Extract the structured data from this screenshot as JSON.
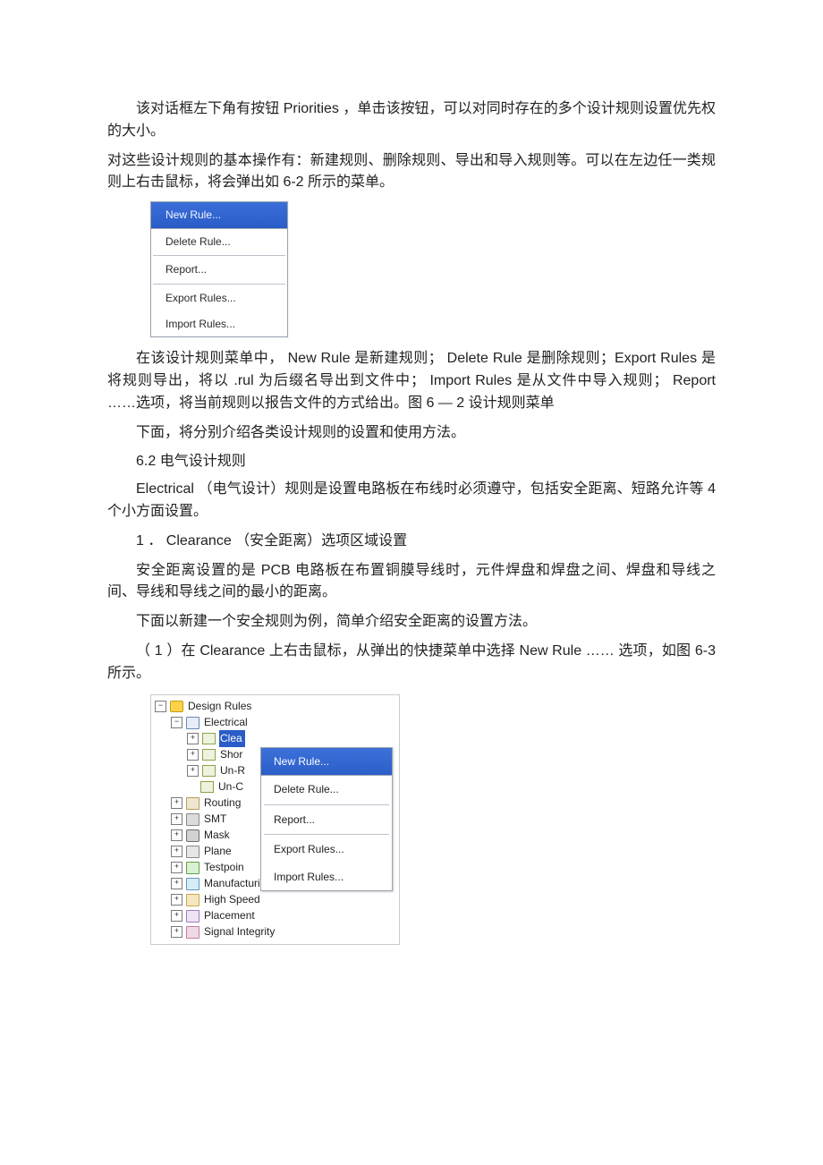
{
  "paragraphs": {
    "p1": "该对话框左下角有按钮 Priorities ，单击该按钮，可以对同时存在的多个设计规则设置优先权的大小。",
    "p2": "对这些设计规则的基本操作有：新建规则、删除规则、导出和导入规则等。可以在左边任一类规则上右击鼠标，将会弹出如 6-2 所示的菜单。",
    "p3": "在该设计规则菜单中， New Rule 是新建规则； Delete Rule 是删除规则；Export Rules 是将规则导出，将以 .rul 为后缀名导出到文件中； Import Rules 是从文件中导入规则； Report ……选项，将当前规则以报告文件的方式给出。图 6 — 2 设计规则菜单",
    "p4": "下面，将分别介绍各类设计规则的设置和使用方法。",
    "s62": "6.2  电气设计规则",
    "p5": "Electrical （电气设计）规则是设置电路板在布线时必须遵守，包括安全距离、短路允许等 4 个小方面设置。",
    "p6": "1 ．  Clearance （安全距离）选项区域设置",
    "p7": "安全距离设置的是 PCB  电路板在布置铜膜导线时，元件焊盘和焊盘之间、焊盘和导线之间、导线和导线之间的最小的距离。",
    "p8": "下面以新建一个安全规则为例，简单介绍安全距离的设置方法。",
    "p9": "（ 1 ）在 Clearance 上右击鼠标，从弹出的快捷菜单中选择 New Rule …… 选项，如图 6-3 所示。"
  },
  "menu1": {
    "new_rule": "New Rule...",
    "delete_rule": "Delete Rule...",
    "report": "Report...",
    "export_rules": "Export Rules...",
    "import_rules": "Import Rules..."
  },
  "tree": {
    "root": "Design Rules",
    "electrical": "Electrical",
    "clearance_short": "Clea",
    "short_circuit_short": "Shor",
    "un_routed_short": "Un-R",
    "un_conn_short": "Un-C",
    "routing": "Routing",
    "smt": "SMT",
    "mask": "Mask",
    "plane": "Plane",
    "testpoint": "Testpoin",
    "manufacturing": "Manufacturing",
    "high_speed": "High Speed",
    "placement": "Placement",
    "signal_integrity": "Signal Integrity"
  },
  "popup": {
    "new_rule": "New Rule...",
    "delete_rule": "Delete Rule...",
    "report": "Report...",
    "export_rules": "Export Rules...",
    "import_rules": "Import Rules..."
  }
}
